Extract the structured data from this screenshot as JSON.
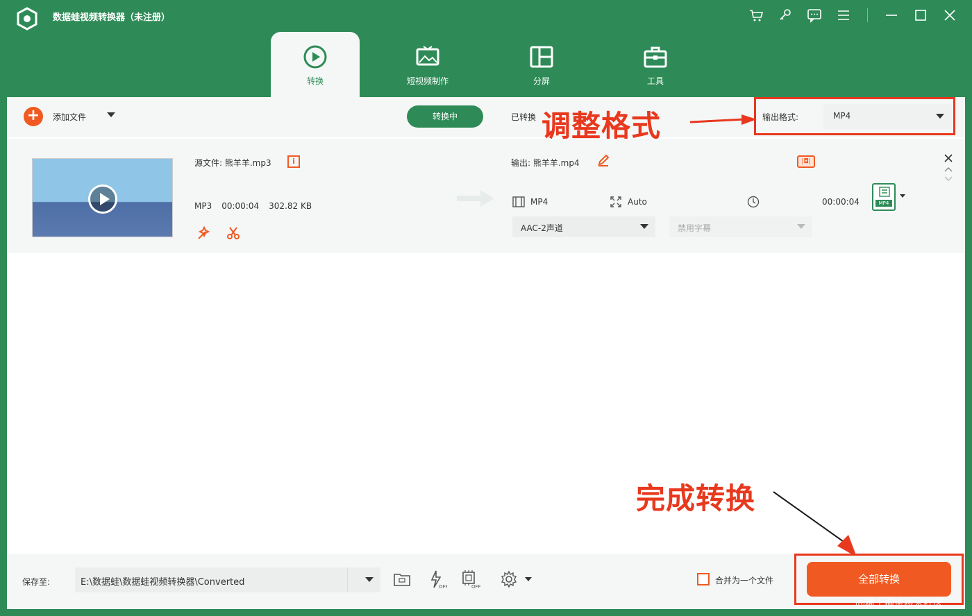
{
  "window": {
    "title": "数据蛙视频转换器（未注册）"
  },
  "tabs": [
    {
      "label": "转换",
      "icon": "convert-icon",
      "active": true
    },
    {
      "label": "短视频制作",
      "icon": "short-video-icon",
      "active": false
    },
    {
      "label": "分屏",
      "icon": "split-screen-icon",
      "active": false
    },
    {
      "label": "工具",
      "icon": "toolbox-icon",
      "active": false
    }
  ],
  "toolbar": {
    "add_file_label": "添加文件",
    "converting_label": "转换中",
    "converted_label": "已转换",
    "output_format_label": "输出格式:",
    "output_format_value": "MP4"
  },
  "annotations": {
    "adjust_format": "调整格式",
    "complete_convert": "完成转换"
  },
  "file": {
    "source_name": "源文件: 熊羊羊.mp3",
    "format": "MP3",
    "duration": "00:00:04",
    "size": "302.82 KB",
    "output_name": "输出: 熊羊羊.mp4",
    "output_format": "MP4",
    "resolution": "Auto",
    "output_duration": "00:00:04",
    "audio_track": "AAC-2声道",
    "subtitle": "禁用字幕",
    "format_tag": "MP4"
  },
  "bottom": {
    "save_to_label": "保存至:",
    "save_path": "E:\\数据蛙\\数据蛙视频转换器\\Converted",
    "merge_label": "合并为一个文件",
    "convert_all_label": "全部转换"
  },
  "watermark": "@稀土掘金技术社区",
  "colors": {
    "brand_green": "#2e8b57",
    "accent_orange": "#f05a22",
    "annotation_red": "#e8381e"
  }
}
